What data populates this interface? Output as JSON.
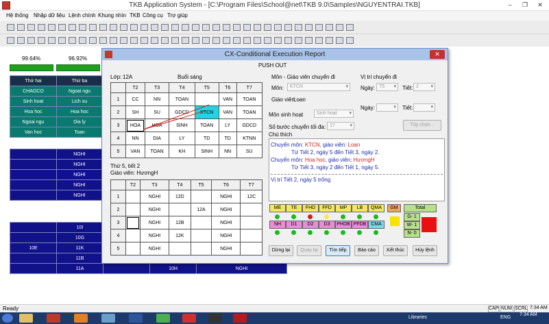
{
  "window": {
    "title": "TKB Application System - [C:\\Program Files\\School@net\\TKB 9.0\\Samples\\NGUYENTRAI.TKB]"
  },
  "menu": [
    "Hệ thống",
    "Nhập dữ liệu",
    "Lệnh chính",
    "Khung nhìn",
    "TKB",
    "Công cụ",
    "Trợ giúp"
  ],
  "background": {
    "pct1": "99.64%",
    "pct2": "96.92%",
    "head": [
      "Thứ hai",
      "Thứ ba"
    ],
    "rows": [
      [
        "CHAOCO",
        "Ngoai ngu"
      ],
      [
        "Sinh hoat",
        "Lich su"
      ],
      [
        "Hoa hoc",
        "Hoa hoc"
      ],
      [
        "Ngoai ngu",
        "Dia ly"
      ],
      [
        "Van hoc",
        "Toan"
      ]
    ],
    "nghi_rows": [
      "NGHI",
      "NGHI",
      "NGHI",
      "NGHI",
      "NGHI"
    ],
    "lower": {
      "rows": [
        [
          "",
          "10I",
          "",
          "",
          ""
        ],
        [
          "",
          "10G",
          "",
          "",
          ""
        ],
        [
          "10E",
          "11K",
          "",
          "",
          ""
        ],
        [
          "",
          "11B",
          "",
          "",
          ""
        ],
        [
          "",
          "11A",
          "",
          "10H",
          "NGHI"
        ]
      ]
    }
  },
  "status": {
    "ready": "Ready",
    "caps": "CAP",
    "num": "NUM",
    "scrl": "SCRL",
    "time": "7:34 AM"
  },
  "taskbar": {
    "libraries": "Libraries",
    "lang": "ENG",
    "time": "7:34 AM"
  },
  "dialog": {
    "title": "CX-Conditional Execution Report",
    "subtitle": "PUSH OUT",
    "close": "✕",
    "lop_label": "Lớp:",
    "lop_value": "12A",
    "session": "Buổi sáng",
    "top_grid": {
      "cols": [
        "T2",
        "T3",
        "T4",
        "T5",
        "T6",
        "T7"
      ],
      "rows": [
        [
          "1",
          "CC",
          "NN",
          "TOAN",
          "",
          "VAN",
          "TOAN"
        ],
        [
          "2",
          "SH",
          "SU",
          "GDCD",
          "KTCN",
          "VAN",
          "TOAN"
        ],
        [
          "3",
          "HOA",
          "HOA",
          "SINH",
          "TOAN",
          "LY",
          "GDCD"
        ],
        [
          "4",
          "NN",
          "DIA",
          "LY",
          "TD",
          "TD",
          "KTNN"
        ],
        [
          "5",
          "VAN",
          "TOAN",
          "KH",
          "SINH",
          "NN",
          "SU"
        ]
      ]
    },
    "thu_label": "Thứ 5, tiết 2",
    "gv_label": "Giáo viên: HươngH",
    "bottom_grid": {
      "cols": [
        "T2",
        "T3",
        "T4",
        "T5",
        "T6",
        "T7"
      ],
      "rows": [
        [
          "1",
          "",
          "NGHI",
          "12D",
          "",
          "NGHI",
          "12C"
        ],
        [
          "2",
          "",
          "NGHI",
          "",
          "12A",
          "NGHI",
          ""
        ],
        [
          "3",
          "",
          "NGHI",
          "12B",
          "",
          "NGHI",
          ""
        ],
        [
          "4",
          "",
          "NGHI",
          "12K",
          "",
          "NGHI",
          ""
        ],
        [
          "5",
          "",
          "NGHI",
          "",
          "",
          "NGHI",
          ""
        ]
      ]
    },
    "mon_gv_title": "Môn - Giáo viên chuyển đi",
    "mon_label": "Môn:",
    "mon_value": "KTCN",
    "gv_title_label": "Giáo viên:",
    "gv_value": "Loan",
    "vitri_title": "Vị trí chuyển đi",
    "ngay_label": "Ngày:",
    "ngay_value": "T5",
    "tiet_label": "Tiết:",
    "tiet_value": "2",
    "ngay2_label": "Ngày:",
    "tiet2_label": "Tiết:",
    "monsh_label": "Môn sinh hoạt",
    "monsh_value": "Sinh hoạt",
    "sobuoc_label": "Số bước chuyển tối đa:",
    "sobuoc_value": "17",
    "tuychon": "Tùy chọn...",
    "chuthich": "Chú thích",
    "notes": {
      "l1a": "Chuyển môn: ",
      "l1b": "KTCN",
      "l1c": ", giáo viên: ",
      "l1d": "Loan",
      "l2": "Từ Tiết 2, ngày 5 đến Tiết 3, ngày 2.",
      "l3a": "Chuyển môn: ",
      "l3b": "Hoa hoc",
      "l3c": ", giáo viên: ",
      "l3d": "HươngH",
      "l4": "Từ Tiết 3, ngày 2 đến Tiết 1, ngày 5.",
      "l5": "Vị trí Tiết 2, ngày 5 trống"
    },
    "legend": {
      "row1": [
        "ME",
        "TE",
        "FHD",
        "FFD",
        "MP",
        "LB",
        "QMA"
      ],
      "row2": [
        "NH",
        "D1",
        "D2",
        "D3",
        "PHDB",
        "PFDB",
        "CMA"
      ],
      "gm": "GM",
      "total": "Total",
      "g1": "G- 1",
      "w1": "W- 1",
      "n0": "N- 0"
    },
    "buttons": {
      "dung": "Dừng lại",
      "quay": "Quay lại",
      "tim": "Tìm tiếp",
      "baocao": "Báo cáo",
      "ketthuc": "Kết thúc",
      "huy": "Hủy lệnh"
    }
  }
}
